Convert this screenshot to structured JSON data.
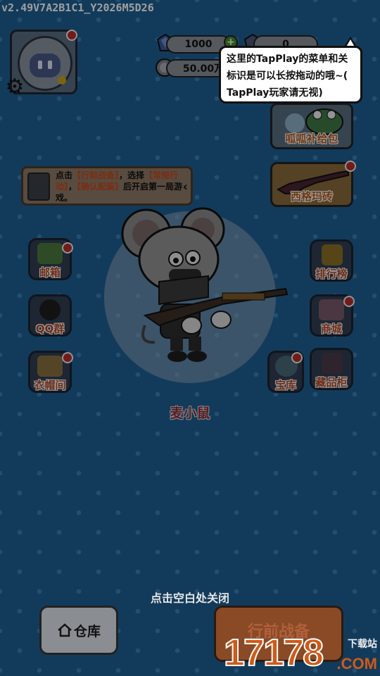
{
  "version": "v2.49V7A2B1C1_Y2026M5D26",
  "currency": {
    "gems": "1000",
    "tickets": "0",
    "coins": "50.00万"
  },
  "tooltip": {
    "text_line1": "这里的TapPlay的菜单和关",
    "text_line2": "标识是可以长按拖动的哦~(",
    "text_line3": "TapPlay玩家请无视)"
  },
  "right_panel": {
    "supply_label": "呱呱补给包",
    "weapon_label": "西格玛砖",
    "leaderboard_label": "排行榜",
    "shop_label": "商城",
    "treasury_label": "宝库",
    "collection_label": "藏品柜"
  },
  "left_panel": {
    "mail_label": "邮箱",
    "qq_label": "QQ群",
    "wardrobe_label": "衣帽间"
  },
  "hint": {
    "p1": "点击",
    "h1": "【行前战备】",
    "p2": "，选择",
    "h2": "【常规行动】",
    "p3": "，",
    "h3": "【确认配装】",
    "p4": "后开启第一局游戏。"
  },
  "character": {
    "name": "麦小鼠"
  },
  "close_hint": "点击空白处关闭",
  "bottom": {
    "warehouse_label": "仓库",
    "start_label": "行前战备"
  },
  "watermark": {
    "number": "17178",
    "suffix": ".COM",
    "download": "下载站"
  },
  "colors": {
    "background": "#1d5f94",
    "accent_text": "#b14a28",
    "notification": "#b72d2d"
  },
  "icons": [
    "gear-icon",
    "gem-icon",
    "coin-icon",
    "plus-icon",
    "home-icon",
    "chevron-left-icon"
  ]
}
